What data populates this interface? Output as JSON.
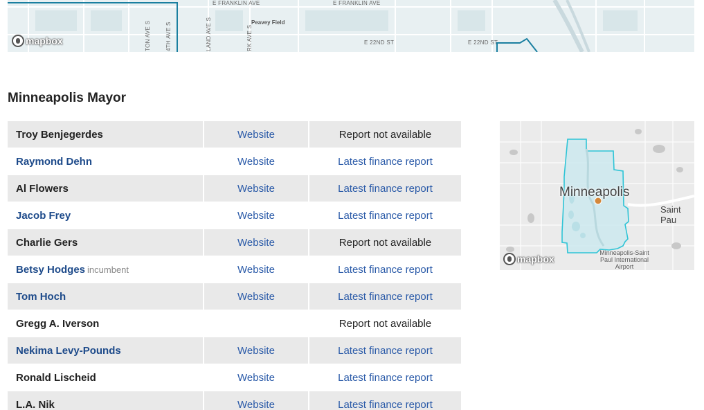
{
  "top_map": {
    "streets": {
      "franklin_1": "E FRANKLIN AVE",
      "franklin_2": "E FRANKLIN AVE",
      "e22nd_1": "E 22ND ST",
      "e22nd_2": "E 22ND ST",
      "ave_1": "TON AVE S",
      "ave_2": "4TH AVE S",
      "ave_3": "LAND AVE S",
      "ave_4": "RK AVE S"
    },
    "poi": "Peavey Field",
    "attribution": "mapbox"
  },
  "section": {
    "title": "Minneapolis Mayor"
  },
  "candidates": [
    {
      "name": "Troy Benjegerdes",
      "website": "Website",
      "report": "Report not available"
    },
    {
      "name": "Raymond Dehn",
      "website": "Website",
      "report": "Latest finance report"
    },
    {
      "name": "Al Flowers",
      "website": "Website",
      "report": "Latest finance report"
    },
    {
      "name": "Jacob Frey",
      "website": "Website",
      "report": "Latest finance report"
    },
    {
      "name": "Charlie Gers",
      "website": "Website",
      "report": "Report not available"
    },
    {
      "name": "Betsy Hodges",
      "tag": "incumbent",
      "website": "Website",
      "report": "Latest finance report"
    },
    {
      "name": "Tom Hoch",
      "website": "Website",
      "report": "Latest finance report"
    },
    {
      "name": "Gregg A. Iverson",
      "website": "",
      "report": "Report not available"
    },
    {
      "name": "Nekima Levy-Pounds",
      "website": "Website",
      "report": "Latest finance report"
    },
    {
      "name": "Ronald Lischeid",
      "website": "Website",
      "report": "Latest finance report"
    },
    {
      "name": "L.A. Nik",
      "website": "Website",
      "report": "Latest finance report"
    }
  ],
  "mini_map": {
    "city": "Minneapolis",
    "neighbor": "Saint Pau",
    "airport_line1": "Minneapolis-Saint",
    "airport_line2": "Paul International",
    "airport_line3": "Airport",
    "attribution": "mapbox",
    "boundary_color": "#2ec4d6",
    "marker_color": "#d4873a"
  }
}
